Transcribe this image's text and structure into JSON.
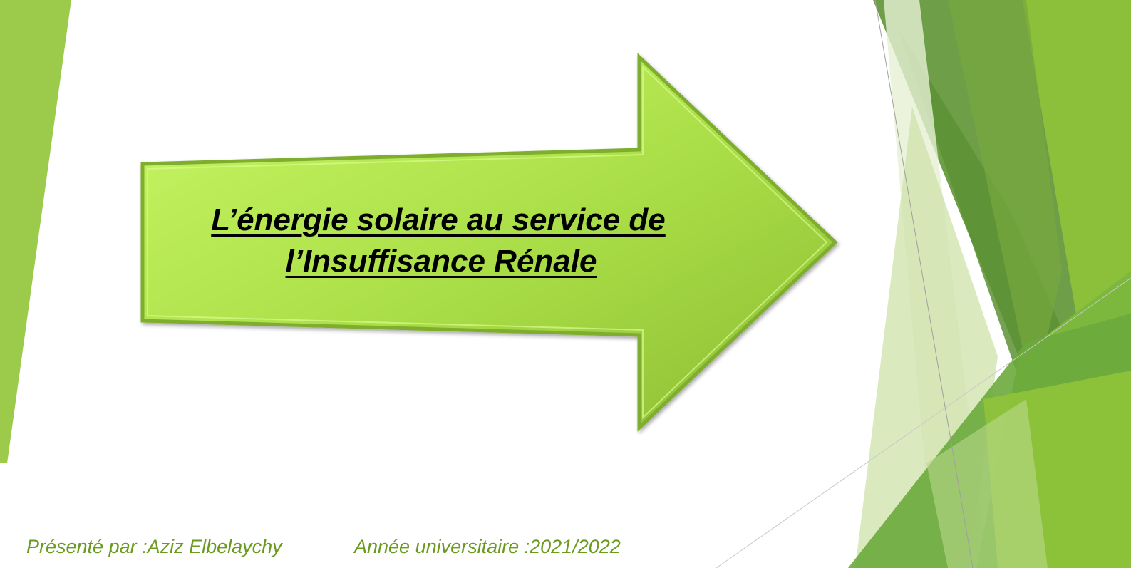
{
  "slide": {
    "title_line1": "L’énergie solaire au service de",
    "title_line2": "l’Insuffisance Rénale",
    "presenter": "Présenté par :Aziz Elbelaychy",
    "academic_year": "Année universitaire :2021/2022"
  },
  "theme": {
    "accent": "#9bc94a",
    "accent_dark": "#5e8f33",
    "arrow_fill_light": "#c7f564",
    "arrow_fill_dark": "#8fc13a",
    "footer_text": "#6a9a1e"
  }
}
